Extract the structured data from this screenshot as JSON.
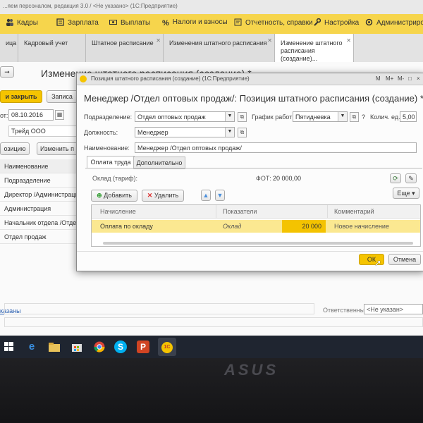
{
  "window": {
    "title_fragment": "...яем персоналом, редакция 3.0 / <Не указано> (1С:Предприятие)"
  },
  "menu": [
    {
      "label": "Кадры",
      "icon": "people-icon"
    },
    {
      "label": "Зарплата",
      "icon": "salary-icon"
    },
    {
      "label": "Выплаты",
      "icon": "payments-icon"
    },
    {
      "label": "Налоги и взносы",
      "icon": "percent-icon"
    },
    {
      "label": "Отчетность, справки",
      "icon": "reports-icon"
    },
    {
      "label": "Настройка",
      "icon": "wrench-icon"
    },
    {
      "label": "Администриров",
      "icon": "admin-icon"
    }
  ],
  "tabs": [
    {
      "label": "ица"
    },
    {
      "label": "Кадровый учет"
    },
    {
      "label": "Штатное расписание"
    },
    {
      "label": "Изменения штатного расписания"
    },
    {
      "label": "Изменение штатного расписания (создание)..."
    }
  ],
  "background_form": {
    "title": "Изменение штатного расписания (создание) *",
    "save_close_label": "и закрыть",
    "write_label": "Записа",
    "date_label": "от:",
    "date_value": "08.10.2016",
    "org_value": "Трейд ООО",
    "add_position_label": "озицию",
    "change_position_label": "Изменить п",
    "rows": [
      "Наименование",
      "Подразделение",
      "Директор /Администрация",
      "Администрация",
      "Начальник отдела /Отде",
      "Отдел продаж"
    ],
    "not_specified_link": "казаны",
    "responsible_label": "Ответственный",
    "responsible_value": "<Не указан>"
  },
  "dialog": {
    "titlebar": "Позиция штатного расписания (создание) (1С:Предприятие)",
    "controls": [
      "M",
      "M+",
      "M-",
      "□",
      "×"
    ],
    "heading": "Менеджер /Отдел оптовых продаж/: Позиция штатного расписания (создание) *",
    "subdivision_label": "Подразделение:",
    "subdivision_value": "Отдел оптовых продаж",
    "schedule_label": "График работы:",
    "schedule_value": "Пятидневка",
    "rate_label": "Колич. ед.:",
    "rate_value": "5,00",
    "position_label": "Должность:",
    "position_value": "Менеджер",
    "name_label": "Наименование:",
    "name_value": "Менеджер /Отдел оптовых продаж/",
    "help": "?",
    "tab_pay": "Оплата труда",
    "tab_extra": "Дополнительно",
    "tariff_label": "Оклад (тариф):",
    "fot_label": "ФОТ:",
    "fot_value": "20 000,00",
    "add_label": "Добавить",
    "delete_label": "Удалить",
    "more_label": "Еще",
    "table_headers": [
      "Начисление",
      "Показатели",
      "Комментарий"
    ],
    "table_row": {
      "accrual": "Оплата по окладу",
      "indicator": "Оклад",
      "amount": "20 000",
      "comment": "Новое начисление"
    },
    "ok_label": "ОК",
    "cancel_label": "Отмена"
  },
  "colors": {
    "menubar": "#f6d54c",
    "save_button": "#f5c400",
    "selected_row": "#fbe891",
    "amount_cell": "#f4c300",
    "blue_arrows": "#4a8fdc"
  },
  "taskbar": {
    "icons": [
      "windows-start-icon",
      "edge-icon",
      "file-explorer-icon",
      "store-icon",
      "chrome-icon",
      "skype-icon",
      "powerpoint-icon",
      "1c-icon"
    ]
  },
  "laptop_brand": "ASUS"
}
